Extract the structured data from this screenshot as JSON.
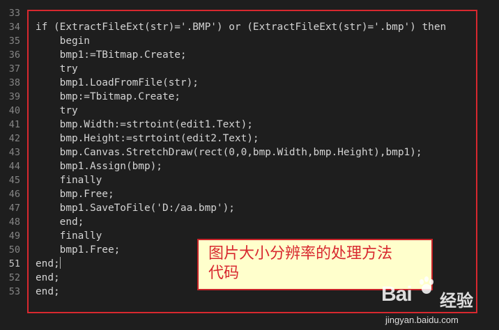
{
  "editor": {
    "active_line": "51",
    "lines": [
      {
        "num": "33",
        "code": ""
      },
      {
        "num": "34",
        "code": "if (ExtractFileExt(str)='.BMP') or (ExtractFileExt(str)='.bmp') then"
      },
      {
        "num": "35",
        "code": "    begin"
      },
      {
        "num": "36",
        "code": "    bmp1:=TBitmap.Create;"
      },
      {
        "num": "37",
        "code": "    try"
      },
      {
        "num": "38",
        "code": "    bmp1.LoadFromFile(str);"
      },
      {
        "num": "39",
        "code": "    bmp:=Tbitmap.Create;"
      },
      {
        "num": "40",
        "code": "    try"
      },
      {
        "num": "41",
        "code": "    bmp.Width:=strtoint(edit1.Text);"
      },
      {
        "num": "42",
        "code": "    bmp.Height:=strtoint(edit2.Text);"
      },
      {
        "num": "43",
        "code": "    bmp.Canvas.StretchDraw(rect(0,0,bmp.Width,bmp.Height),bmp1);"
      },
      {
        "num": "44",
        "code": "    bmp1.Assign(bmp);"
      },
      {
        "num": "45",
        "code": "    finally"
      },
      {
        "num": "46",
        "code": "    bmp.Free;"
      },
      {
        "num": "47",
        "code": "    bmp1.SaveToFile('D:/aa.bmp');"
      },
      {
        "num": "48",
        "code": "    end;"
      },
      {
        "num": "49",
        "code": "    finally"
      },
      {
        "num": "50",
        "code": "    bmp1.Free;"
      },
      {
        "num": "51",
        "code": "end;"
      },
      {
        "num": "52",
        "code": "end;"
      },
      {
        "num": "53",
        "code": "end;"
      }
    ]
  },
  "annotation": {
    "line1": "图片大小分辨率的处理方法",
    "line2": "代码"
  },
  "watermark": {
    "logo": "Bai",
    "logo_suffix": "经验",
    "url": "jingyan.baidu.com"
  },
  "colors": {
    "background": "#1e1e1e",
    "code_text": "#d4d4d4",
    "line_number": "#858585",
    "frame_red": "#d8282f",
    "note_bg": "#ffffcc"
  }
}
